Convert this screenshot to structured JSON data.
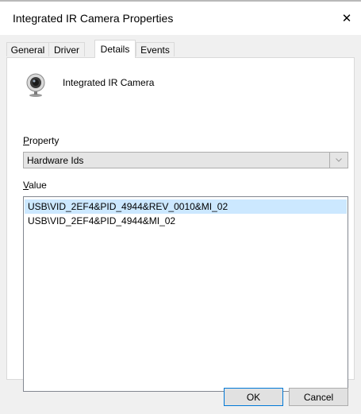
{
  "window": {
    "title": "Integrated IR Camera Properties",
    "close_glyph": "✕"
  },
  "tabs": [
    {
      "label": "General",
      "active": false
    },
    {
      "label": "Driver",
      "active": false
    },
    {
      "label": "Details",
      "active": true
    },
    {
      "label": "Events",
      "active": false
    }
  ],
  "device": {
    "name": "Integrated IR Camera",
    "icon": "webcam-icon"
  },
  "property": {
    "label_hotkey": "P",
    "label_rest": "roperty",
    "selected": "Hardware Ids"
  },
  "value": {
    "label_hotkey": "V",
    "label_rest": "alue",
    "items": [
      "USB\\VID_2EF4&PID_4944&REV_0010&MI_02",
      "USB\\VID_2EF4&PID_4944&MI_02"
    ],
    "selected_index": 0
  },
  "buttons": {
    "ok": "OK",
    "cancel": "Cancel"
  },
  "colors": {
    "selection": "#cce8ff",
    "dialog_bg": "#f0f0f0",
    "default_button_border": "#0078d7"
  }
}
